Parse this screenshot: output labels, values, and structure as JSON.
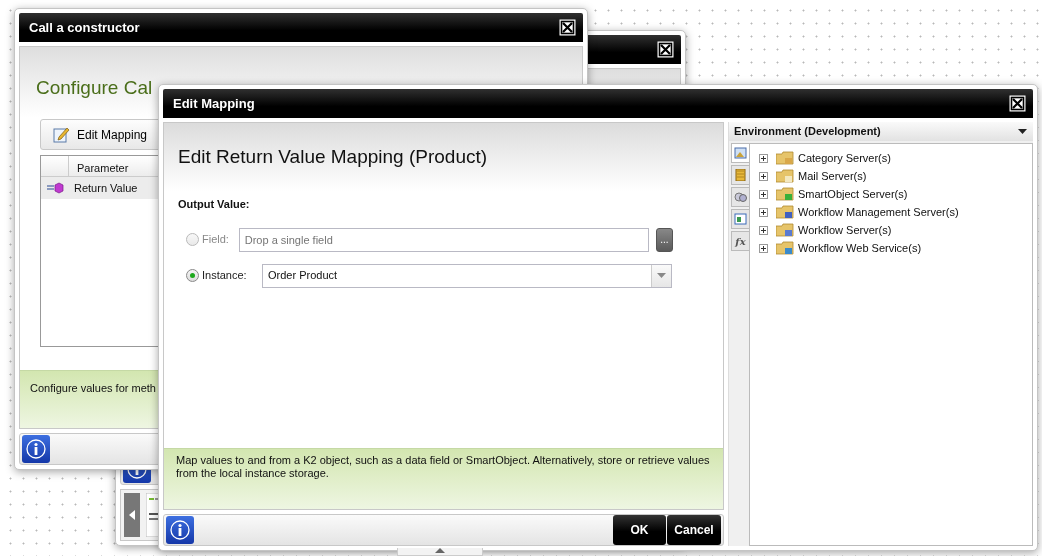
{
  "constructor_dialog": {
    "title": "Call a constructor",
    "heading": "Configure Cal",
    "toolbar_button": "Edit Mapping",
    "grid": {
      "columns": [
        "Parameter"
      ],
      "rows": [
        {
          "parameter": "Return Value",
          "selected": true
        }
      ]
    },
    "info": "Configure values for meth"
  },
  "mapping_dialog": {
    "title": "Edit Mapping",
    "heading": "Edit Return Value Mapping (Product)",
    "section_label": "Output Value:",
    "options": [
      {
        "kind": "field",
        "label": "Field:",
        "placeholder": "Drop a single field",
        "button": "...",
        "selected": false,
        "disabled": true
      },
      {
        "kind": "dropdown",
        "label": "Instance:",
        "value": "Order Product",
        "selected": true,
        "disabled": false
      }
    ],
    "info": "Map values to and from a K2 object, such as a data field or SmartObject. Alternatively, store or retrieve values from the local instance storage.",
    "buttons": [
      "OK",
      "Cancel"
    ]
  },
  "environment_panel": {
    "title": "Environment (Development)",
    "side_tabs": [
      {
        "kind": "picture",
        "selected": true
      },
      {
        "kind": "notebook",
        "selected": false
      },
      {
        "kind": "servers",
        "selected": false
      },
      {
        "kind": "form",
        "selected": false
      },
      {
        "kind": "formula",
        "label": "fx",
        "selected": false
      }
    ],
    "tree": [
      {
        "label": "Category Server(s)",
        "expanded": false
      },
      {
        "label": "Mail Server(s)",
        "expanded": false
      },
      {
        "label": "SmartObject Server(s)",
        "expanded": false
      },
      {
        "label": "Workflow Management Server(s)",
        "expanded": false
      },
      {
        "label": "Workflow Server(s)",
        "expanded": false
      },
      {
        "label": "Workflow Web Service(s)",
        "expanded": false
      }
    ]
  }
}
